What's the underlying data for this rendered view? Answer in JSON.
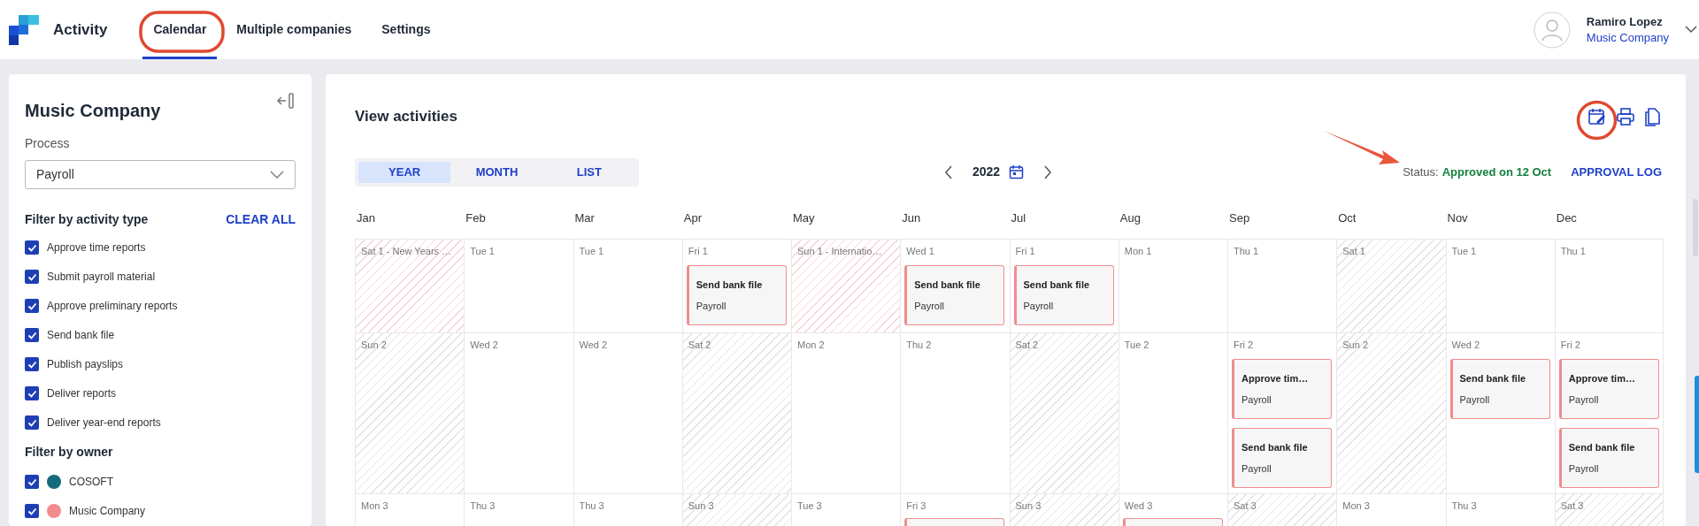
{
  "app": {
    "title": "Activity"
  },
  "tabs": [
    {
      "label": "Calendar",
      "selected": true
    },
    {
      "label": "Multiple companies",
      "selected": false
    },
    {
      "label": "Settings",
      "selected": false
    }
  ],
  "user": {
    "name": "Ramiro Lopez",
    "company": "Music Company"
  },
  "sidebar": {
    "title": "Music Company",
    "process_label": "Process",
    "process_value": "Payroll",
    "activity_heading": "Filter by activity type",
    "clear_all": "CLEAR ALL",
    "activity_types": [
      {
        "label": "Approve time reports",
        "checked": true
      },
      {
        "label": "Submit payroll material",
        "checked": true
      },
      {
        "label": "Approve preliminary reports",
        "checked": true
      },
      {
        "label": "Send bank file",
        "checked": true
      },
      {
        "label": "Publish payslips",
        "checked": true
      },
      {
        "label": "Deliver reports",
        "checked": true
      },
      {
        "label": "Deliver year-end reports",
        "checked": true
      }
    ],
    "owner_heading": "Filter by owner",
    "owners": [
      {
        "label": "COSOFT",
        "checked": true,
        "color": "#146b7c"
      },
      {
        "label": "Music Company",
        "checked": true,
        "color": "#f28b8b"
      }
    ]
  },
  "main": {
    "title": "View activities",
    "views": [
      {
        "label": "YEAR",
        "selected": true
      },
      {
        "label": "MONTH",
        "selected": false
      },
      {
        "label": "LIST",
        "selected": false
      }
    ],
    "year": "2022",
    "status_label": "Status:",
    "status_value": "Approved on 12 Oct",
    "approval_log": "APPROVAL LOG",
    "months": [
      {
        "name": "Jan",
        "days": [
          {
            "label": "Sat 1 - New Years …",
            "kind": "holiday"
          },
          {
            "label": "Sun 2",
            "kind": "weekend"
          },
          {
            "label": "Mon 3",
            "kind": "workday"
          }
        ]
      },
      {
        "name": "Feb",
        "days": [
          {
            "label": "Tue 1",
            "kind": "workday"
          },
          {
            "label": "Wed 2",
            "kind": "workday"
          },
          {
            "label": "Thu 3",
            "kind": "workday"
          }
        ]
      },
      {
        "name": "Mar",
        "days": [
          {
            "label": "Tue 1",
            "kind": "workday"
          },
          {
            "label": "Wed 2",
            "kind": "workday"
          },
          {
            "label": "Thu 3",
            "kind": "workday"
          }
        ]
      },
      {
        "name": "Apr",
        "days": [
          {
            "label": "Fri 1",
            "kind": "workday",
            "events": [
              {
                "title": "Send bank file",
                "process": "Payroll",
                "color": "#f28b8b"
              }
            ]
          },
          {
            "label": "Sat 2",
            "kind": "weekend"
          },
          {
            "label": "Sun 3",
            "kind": "weekend"
          }
        ]
      },
      {
        "name": "May",
        "days": [
          {
            "label": "Sun 1 - Internatio…",
            "kind": "holiday"
          },
          {
            "label": "Mon 2",
            "kind": "workday"
          },
          {
            "label": "Tue 3",
            "kind": "workday"
          }
        ]
      },
      {
        "name": "Jun",
        "days": [
          {
            "label": "Wed 1",
            "kind": "workday",
            "events": [
              {
                "title": "Send bank file",
                "process": "Payroll",
                "color": "#f28b8b"
              }
            ]
          },
          {
            "label": "Thu 2",
            "kind": "workday"
          },
          {
            "label": "Fri 3",
            "kind": "workday",
            "event_below": true
          }
        ]
      },
      {
        "name": "Jul",
        "days": [
          {
            "label": "Fri 1",
            "kind": "workday",
            "events": [
              {
                "title": "Send bank file",
                "process": "Payroll",
                "color": "#f28b8b"
              }
            ]
          },
          {
            "label": "Sat 2",
            "kind": "weekend"
          },
          {
            "label": "Sun 3",
            "kind": "weekend"
          }
        ]
      },
      {
        "name": "Aug",
        "days": [
          {
            "label": "Mon 1",
            "kind": "workday"
          },
          {
            "label": "Tue 2",
            "kind": "workday"
          },
          {
            "label": "Wed 3",
            "kind": "workday",
            "event_below": true
          }
        ]
      },
      {
        "name": "Sep",
        "days": [
          {
            "label": "Thu 1",
            "kind": "workday"
          },
          {
            "label": "Fri 2",
            "kind": "workday",
            "events": [
              {
                "title": "Approve tim…",
                "process": "Payroll",
                "color": "#f28b8b"
              },
              {
                "title": "Send bank file",
                "process": "Payroll",
                "color": "#f28b8b"
              }
            ]
          },
          {
            "label": "Sat 3",
            "kind": "weekend"
          }
        ]
      },
      {
        "name": "Oct",
        "days": [
          {
            "label": "Sat 1",
            "kind": "weekend"
          },
          {
            "label": "Sun 2",
            "kind": "weekend"
          },
          {
            "label": "Mon 3",
            "kind": "workday"
          }
        ]
      },
      {
        "name": "Nov",
        "days": [
          {
            "label": "Tue 1",
            "kind": "workday"
          },
          {
            "label": "Wed 2",
            "kind": "workday",
            "events": [
              {
                "title": "Send bank file",
                "process": "Payroll",
                "color": "#f28b8b"
              }
            ]
          },
          {
            "label": "Thu 3",
            "kind": "workday"
          }
        ]
      },
      {
        "name": "Dec",
        "days": [
          {
            "label": "Thu 1",
            "kind": "workday"
          },
          {
            "label": "Fri 2",
            "kind": "workday",
            "events": [
              {
                "title": "Approve tim…",
                "process": "Payroll",
                "color": "#f28b8b"
              },
              {
                "title": "Send bank file",
                "process": "Payroll",
                "color": "#f28b8b"
              }
            ]
          },
          {
            "label": "Sat 3",
            "kind": "weekend"
          }
        ]
      }
    ]
  }
}
